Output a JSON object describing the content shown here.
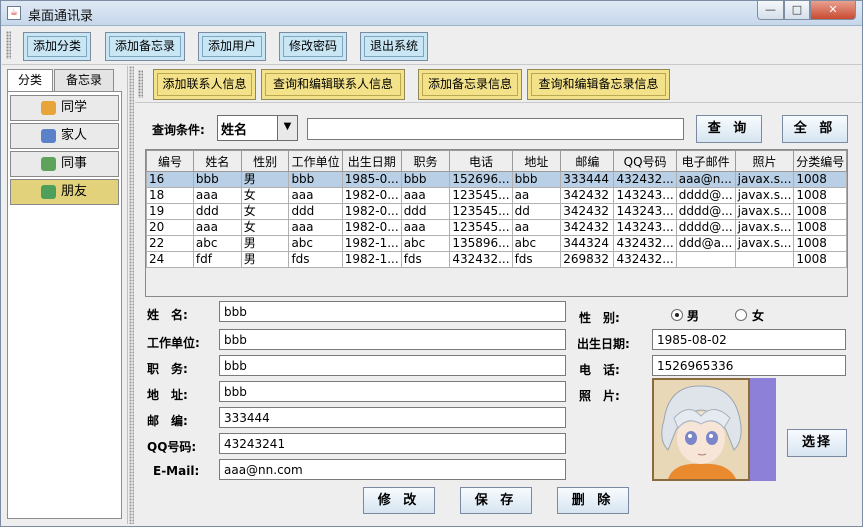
{
  "window": {
    "title": "桌面通讯录",
    "app_icon_glyph": "☕",
    "min_glyph": "—",
    "max_glyph": "□",
    "close_glyph": "✕"
  },
  "toolbar": {
    "add_category": "添加分类",
    "add_memo": "添加备忘录",
    "add_user": "添加用户",
    "change_password": "修改密码",
    "exit_system": "退出系统"
  },
  "left_tabs": {
    "category": "分类",
    "memo": "备忘录"
  },
  "nav": {
    "items": [
      {
        "label": "同学",
        "icon": "classmate-icon",
        "color": "#e6a43a"
      },
      {
        "label": "家人",
        "icon": "family-icon",
        "color": "#5a82c8"
      },
      {
        "label": "同事",
        "icon": "colleague-icon",
        "color": "#5fa35a"
      },
      {
        "label": "朋友",
        "icon": "friend-icon",
        "color": "#4e9e5c"
      }
    ],
    "selected_index": 3
  },
  "actions": {
    "add_contact": "添加联系人信息",
    "query_edit_contact": "查询和编辑联系人信息",
    "add_memo": "添加备忘录信息",
    "query_edit_memo": "查询和编辑备忘录信息"
  },
  "query": {
    "label": "查询条件:",
    "condition": "姓名",
    "value": "",
    "search_button": "查 询",
    "all_button": "全 部",
    "dropdown_glyph": "▼"
  },
  "table": {
    "columns": [
      "编号",
      "姓名",
      "性别",
      "工作单位",
      "出生日期",
      "职务",
      "电话",
      "地址",
      "邮编",
      "QQ号码",
      "电子邮件",
      "照片",
      "分类编号"
    ],
    "rows": [
      [
        "16",
        "bbb",
        "男",
        "bbb",
        "1985-0...",
        "bbb",
        "152696...",
        "bbb",
        "333444",
        "432432...",
        "aaa@n...",
        "javax.s...",
        "1008"
      ],
      [
        "18",
        "aaa",
        "女",
        "aaa",
        "1982-0...",
        "aaa",
        "123545...",
        "aa",
        "342432",
        "143243...",
        "dddd@...",
        "javax.s...",
        "1008"
      ],
      [
        "19",
        "ddd",
        "女",
        "ddd",
        "1982-0...",
        "ddd",
        "123545...",
        "dd",
        "342432",
        "143243...",
        "dddd@...",
        "javax.s...",
        "1008"
      ],
      [
        "20",
        "aaa",
        "女",
        "aaa",
        "1982-0...",
        "aaa",
        "123545...",
        "aa",
        "342432",
        "143243...",
        "dddd@...",
        "javax.s...",
        "1008"
      ],
      [
        "22",
        "abc",
        "男",
        "abc",
        "1982-1...",
        "abc",
        "135896...",
        "abc",
        "344324",
        "432432...",
        "ddd@a...",
        "javax.s...",
        "1008"
      ],
      [
        "24",
        "fdf",
        "男",
        "fds",
        "1982-1...",
        "fds",
        "432432...",
        "fds",
        "269832",
        "432432...",
        "",
        "",
        "1008"
      ]
    ],
    "selected_row": 0
  },
  "form": {
    "name_label": "姓　名:",
    "name": "bbb",
    "company_label": "工作单位:",
    "company": "bbb",
    "position_label": "职　务:",
    "position": "bbb",
    "address_label": "地　址:",
    "address": "bbb",
    "postcode_label": "邮　编:",
    "postcode": "333444",
    "qq_label": "QQ号码:",
    "qq": "43243241",
    "email_label": "E-Mail:",
    "email": "aaa@nn.com",
    "gender_label": "性　别:",
    "gender_male": "男",
    "gender_female": "女",
    "gender_selected": "男",
    "birthday_label": "出生日期:",
    "birthday": "1985-08-02",
    "phone_label": "电　话:",
    "phone": "1526965336",
    "photo_label": "照　片:",
    "choose_button": "选择"
  },
  "bottom_buttons": {
    "modify": "修 改",
    "save": "保 存",
    "delete": "删 除"
  }
}
